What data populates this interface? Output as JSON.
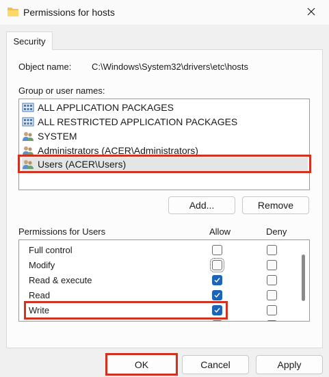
{
  "window": {
    "title": "Permissions for hosts"
  },
  "tabs": [
    {
      "label": "Security",
      "selected": true
    }
  ],
  "object": {
    "label": "Object name:",
    "value": "C:\\Windows\\System32\\drivers\\etc\\hosts"
  },
  "groups": {
    "label": "Group or user names:",
    "items": [
      {
        "label": "ALL APPLICATION PACKAGES",
        "icon": "package-group-icon",
        "selected": false
      },
      {
        "label": "ALL RESTRICTED APPLICATION PACKAGES",
        "icon": "package-group-icon",
        "selected": false
      },
      {
        "label": "SYSTEM",
        "icon": "users-icon",
        "selected": false
      },
      {
        "label": "Administrators (ACER\\Administrators)",
        "icon": "users-icon",
        "selected": false
      },
      {
        "label": "Users (ACER\\Users)",
        "icon": "users-icon",
        "selected": true
      }
    ],
    "add_label": "Add...",
    "remove_label": "Remove"
  },
  "permissions": {
    "label": "Permissions for Users",
    "allow_header": "Allow",
    "deny_header": "Deny",
    "rows": [
      {
        "name": "Full control",
        "allow": false,
        "deny": false
      },
      {
        "name": "Modify",
        "allow": false,
        "deny": false
      },
      {
        "name": "Read & execute",
        "allow": true,
        "deny": false
      },
      {
        "name": "Read",
        "allow": true,
        "deny": false
      },
      {
        "name": "Write",
        "allow": true,
        "deny": false
      }
    ]
  },
  "footer": {
    "ok_label": "OK",
    "cancel_label": "Cancel",
    "apply_label": "Apply"
  },
  "colors": {
    "highlight": "#d1321f",
    "checkbox_checked": "#1c64b8"
  }
}
